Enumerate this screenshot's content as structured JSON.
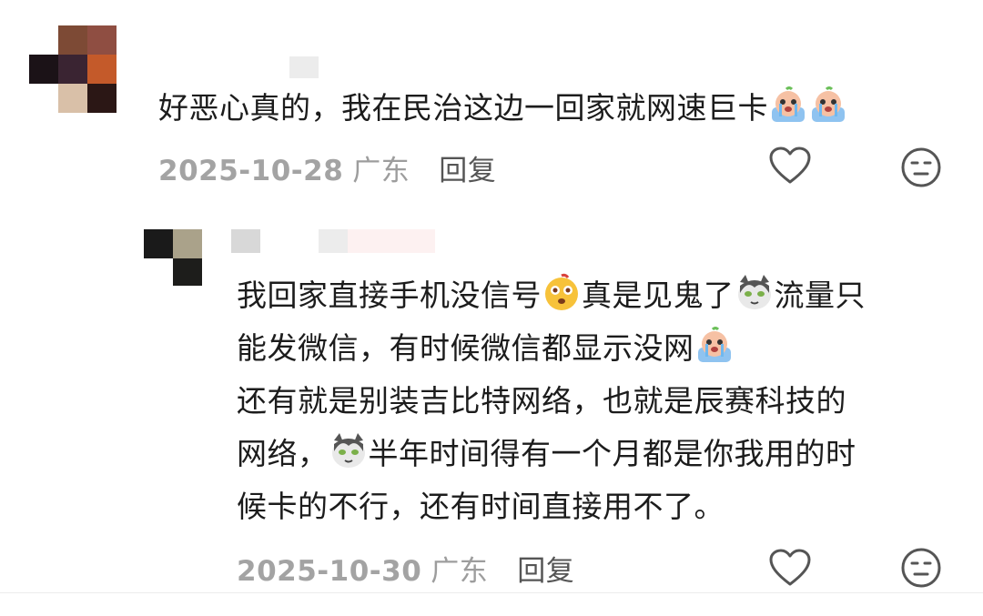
{
  "comments": [
    {
      "text_parts": [
        "好恶心真的，我在民治这边一回家就网速巨卡"
      ],
      "date": "2025-10-28",
      "location": "广东",
      "reply_label": "回复"
    },
    {
      "line1a": "我回家直接手机没信号",
      "line1b": "真是见鬼了",
      "line1c": "流量只",
      "line2": "能发微信，有时候微信都显示没网",
      "line3": "还有就是别装吉比特网络，也就是辰赛科技的",
      "line4a": "网络，",
      "line4b": "半年时间得有一个月都是你我用的时",
      "line5": "候卡的不行，还有时间直接用不了。",
      "date": "2025-10-30",
      "location": "广东",
      "reply_label": "回复"
    }
  ],
  "emojis": {
    "crying": "crying-emoji",
    "surprised": "surprised-emoji",
    "cat": "cat-emoji"
  },
  "colors": {
    "text": "#1c1c1c",
    "meta": "#9d9d9d",
    "reply": "#555555"
  }
}
